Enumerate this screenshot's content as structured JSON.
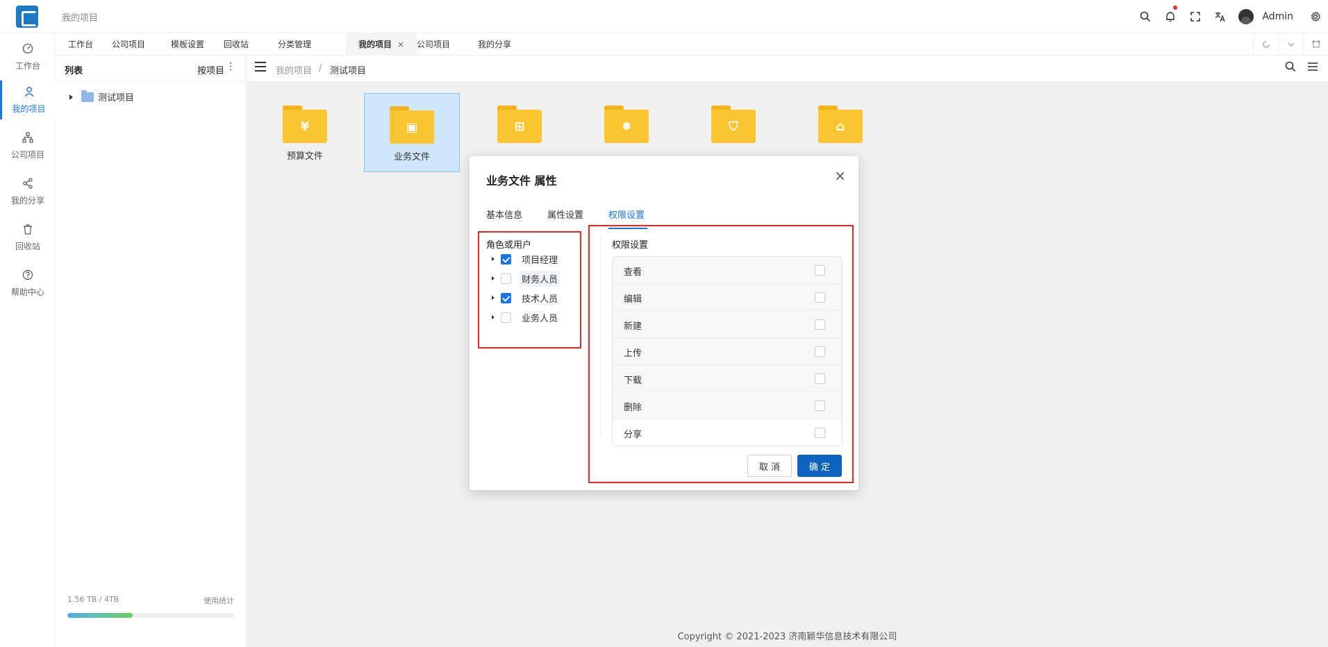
{
  "header": {
    "title": "我的项目",
    "user_name": "Admin",
    "icons": [
      "search-icon",
      "bell-icon",
      "fullscreen-icon",
      "translate-icon",
      "avatar",
      "gear-icon"
    ]
  },
  "leftnav": {
    "items": [
      {
        "label": "工作台",
        "icon": "dashboard-icon"
      },
      {
        "label": "我的项目",
        "icon": "user-icon",
        "active": true
      },
      {
        "label": "公司项目",
        "icon": "org-icon"
      },
      {
        "label": "我的分享",
        "icon": "share-icon"
      },
      {
        "label": "回收站",
        "icon": "trash-icon"
      },
      {
        "label": "帮助中心",
        "icon": "help-icon"
      }
    ]
  },
  "tabs": {
    "items": [
      "工作台",
      "公司项目",
      "模板设置",
      "回收站",
      "分类管理",
      "我的项目",
      "公司项目",
      "我的分享"
    ],
    "active_index": 5,
    "close_glyph": "×"
  },
  "tree": {
    "title": "列表",
    "sort_label": "按项目",
    "more_glyph": "⋮",
    "node_label": "测试项目"
  },
  "storage": {
    "usage": "1.56 TB / 4TB",
    "stats_link": "使用统计",
    "fill_fraction": 0.39
  },
  "breadcrumb": {
    "root": "我的项目",
    "sep": "/",
    "current": "测试项目"
  },
  "folders": [
    {
      "name": "预算文件",
      "glyph": "¥"
    },
    {
      "name": "业务文件",
      "glyph": "▣",
      "selected": true
    },
    {
      "name": "",
      "glyph": "⊞"
    },
    {
      "name": "",
      "glyph": "✹"
    },
    {
      "name": "",
      "glyph": "⛉"
    },
    {
      "name": "",
      "glyph": "⌂"
    }
  ],
  "footer": "Copyright © 2021-2023 济南颖华信息技术有限公司",
  "dialog": {
    "title": "业务文件 属性",
    "close_glyph": "×",
    "tabs": [
      "基本信息",
      "属性设置",
      "权限设置"
    ],
    "active_tab": 2,
    "roles_header": "角色或用户",
    "roles": [
      {
        "label": "项目经理",
        "checked": true
      },
      {
        "label": "财务人员",
        "checked": false
      },
      {
        "label": "技术人员",
        "checked": true
      },
      {
        "label": "业务人员",
        "checked": false
      }
    ],
    "perm_header": "权限设置",
    "permissions": [
      "查看",
      "编辑",
      "新建",
      "上传",
      "下载",
      "删除",
      "分享"
    ],
    "cancel_label": "取 消",
    "ok_label": "确 定"
  },
  "colors": {
    "accent": "#1a73e8",
    "primary_button": "#0d64be",
    "highlight_border": "#e62626",
    "folder_yellow": "#fbc531"
  }
}
